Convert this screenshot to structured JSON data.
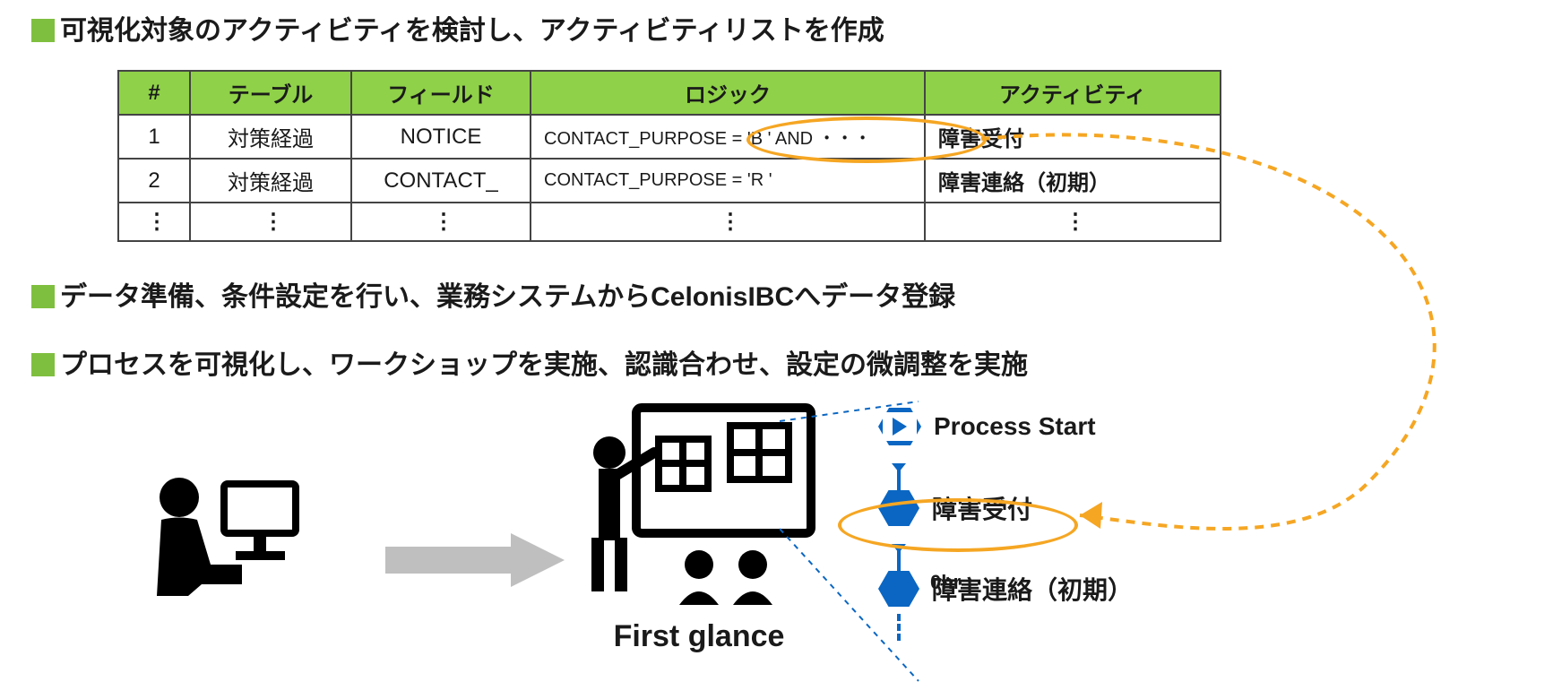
{
  "bullets": {
    "b1": "可視化対象のアクティビティを検討し、アクティビティリストを作成",
    "b2": "データ準備、条件設定を行い、業務システムからCelonisIBCへデータ登録",
    "b3": "プロセスを可視化し、ワークショップを実施、認識合わせ、設定の微調整を実施"
  },
  "table": {
    "headers": {
      "num": "#",
      "table": "テーブル",
      "field": "フィールド",
      "logic": "ロジック",
      "activity": "アクティビティ"
    },
    "rows": [
      {
        "num": "1",
        "table": "対策経過",
        "field": "NOTICE",
        "logic": "CONTACT_PURPOSE = 'B ' AND ・・・",
        "activity": "障害受付"
      },
      {
        "num": "2",
        "table": "対策経過",
        "field": "CONTACT_",
        "logic": "CONTACT_PURPOSE = 'R   '",
        "activity": "障害連絡（初期）"
      }
    ]
  },
  "first_glance": "First glance",
  "flow": {
    "start": "Process Start",
    "n1": "障害受付",
    "hrs": "0hr",
    "n2": "障害連絡（初期）"
  }
}
